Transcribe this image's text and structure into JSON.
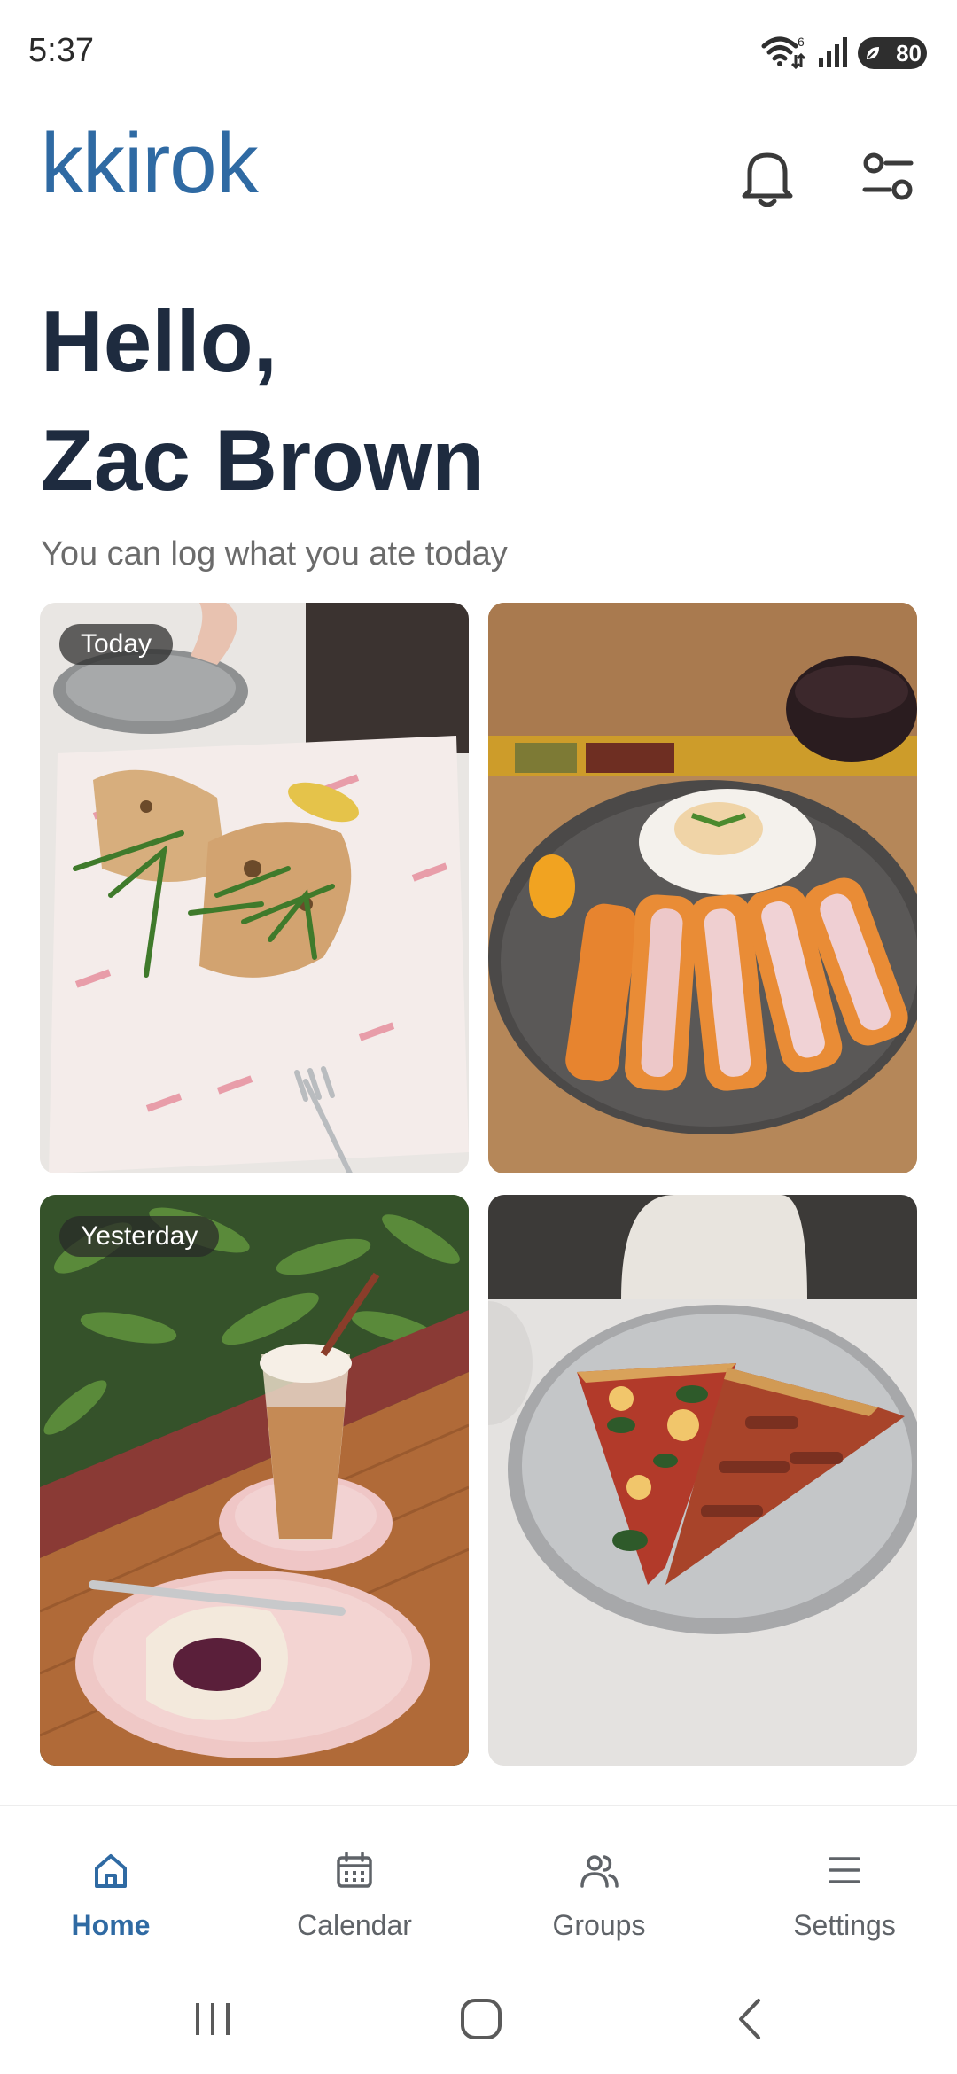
{
  "status_bar": {
    "time": "5:37",
    "wifi_badge": "6",
    "battery": "80",
    "icons": [
      "wifi-icon",
      "signal-icon",
      "battery-icon"
    ]
  },
  "header": {
    "logo": "kkirok",
    "icons": [
      "bell-icon",
      "filters-icon"
    ]
  },
  "greeting": {
    "line1": "Hello,",
    "line2": "Zac Brown",
    "subtitle": "You can log what you ate today"
  },
  "photos": [
    {
      "badge": "Today",
      "subject": "flatbread-sandwich"
    },
    {
      "badge": "",
      "subject": "tonkatsu"
    },
    {
      "badge": "Yesterday",
      "subject": "iced-coffee-and-galette"
    },
    {
      "badge": "",
      "subject": "pizza-slices"
    }
  ],
  "bottom_nav": {
    "items": [
      {
        "label": "Home",
        "icon": "home-icon",
        "active": true
      },
      {
        "label": "Calendar",
        "icon": "calendar-icon",
        "active": false
      },
      {
        "label": "Groups",
        "icon": "groups-icon",
        "active": false
      },
      {
        "label": "Settings",
        "icon": "menu-icon",
        "active": false
      }
    ]
  },
  "colors": {
    "brand": "#2f6aa3",
    "heading": "#1e2b3f",
    "muted": "#6b6b6b",
    "nav_inactive": "#5f6368"
  }
}
